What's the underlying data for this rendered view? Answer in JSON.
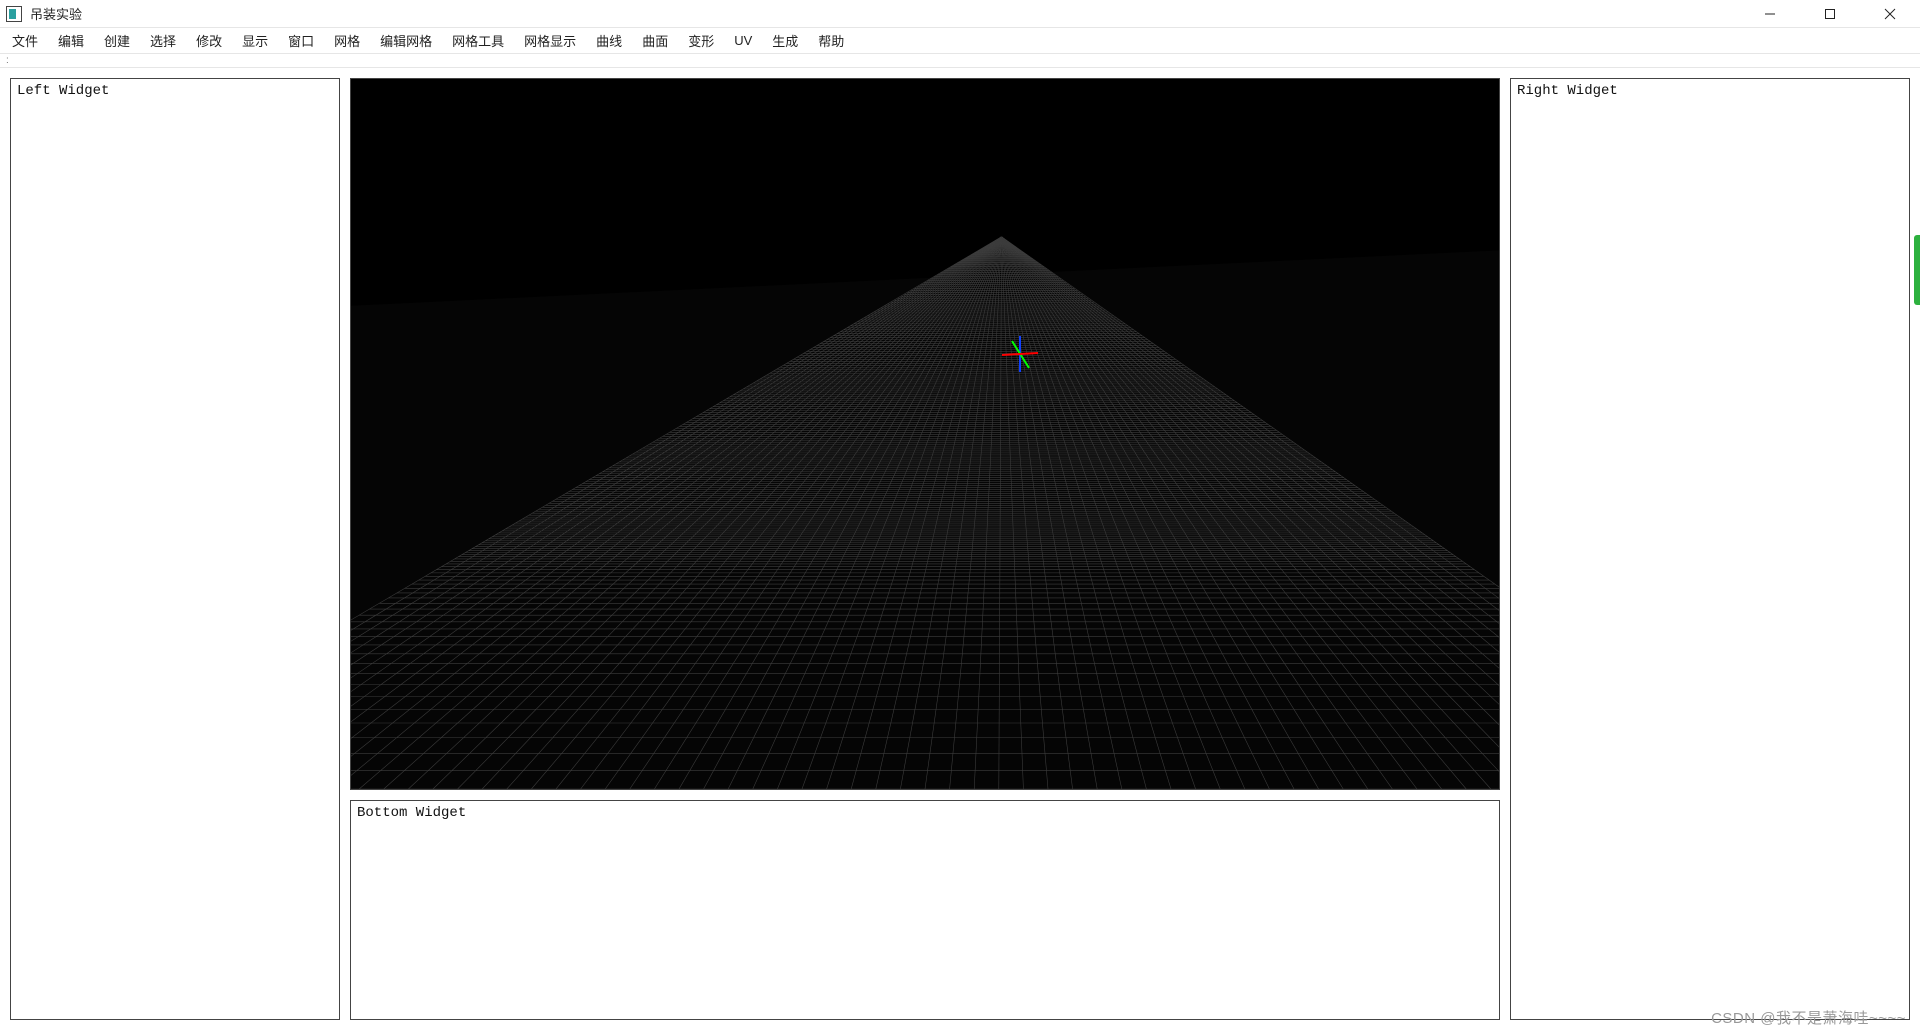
{
  "window": {
    "title": "吊装实验"
  },
  "menubar": {
    "items": [
      "文件",
      "编辑",
      "创建",
      "选择",
      "修改",
      "显示",
      "窗口",
      "网格",
      "编辑网格",
      "网格工具",
      "网格显示",
      "曲线",
      "曲面",
      "变形",
      "UV",
      "生成",
      "帮助"
    ]
  },
  "panels": {
    "left_label": "Left Widget",
    "right_label": "Right Widget",
    "bottom_label": "Bottom Widget"
  },
  "watermark": {
    "text": "CSDN @我不是萧海哇~~~~"
  },
  "toolbar_strip": {
    "hint": ":"
  },
  "gizmo": {
    "x_axis_color": "#ff0000",
    "y_axis_color": "#00ff00",
    "z_axis_color": "#1040ff"
  }
}
